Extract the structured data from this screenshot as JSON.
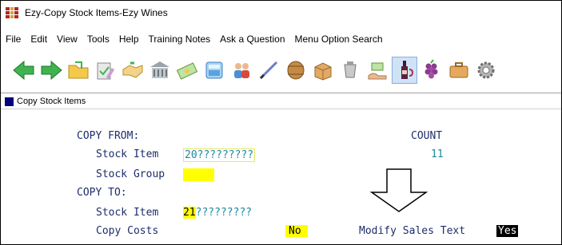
{
  "window": {
    "title": "Ezy-Copy Stock Items-Ezy Wines"
  },
  "menu": [
    "File",
    "Edit",
    "View",
    "Tools",
    "Help",
    "Training Notes",
    "Ask a Question",
    "Menu Option Search"
  ],
  "toolbar": {
    "icons": [
      "back-arrow-icon",
      "forward-arrow-icon",
      "folder-icon",
      "edit-check-icon",
      "handshake-icon",
      "bank-building-icon",
      "money-icon",
      "calculator-icon",
      "people-icon",
      "pen-icon",
      "barrel-icon",
      "box-icon",
      "cup-icon",
      "hand-money-icon",
      "wine-bottle-icon",
      "grapes-icon",
      "briefcase-icon",
      "gear-icon"
    ],
    "active_index": 14
  },
  "subheader": {
    "title": "Copy Stock Items"
  },
  "form": {
    "copy_from_heading": "COPY FROM:",
    "count_heading": "COUNT",
    "from_stock_item_label": "Stock Item",
    "from_stock_item_value": "20?????????",
    "count_value": "11",
    "from_stock_group_label": "Stock Group",
    "from_stock_group_value": "",
    "copy_to_heading": "COPY TO:",
    "to_stock_item_label": "Stock Item",
    "to_stock_item_prefix": "21",
    "to_stock_item_rest": "?????????",
    "copy_costs_label": "Copy Costs",
    "copy_costs_value": "No",
    "modify_sales_text_label": "Modify Sales Text",
    "modify_sales_text_value": "Yes"
  },
  "colors": {
    "label": "#1d2d6b",
    "value": "#1e8aa0",
    "highlight": "#ffff00"
  }
}
